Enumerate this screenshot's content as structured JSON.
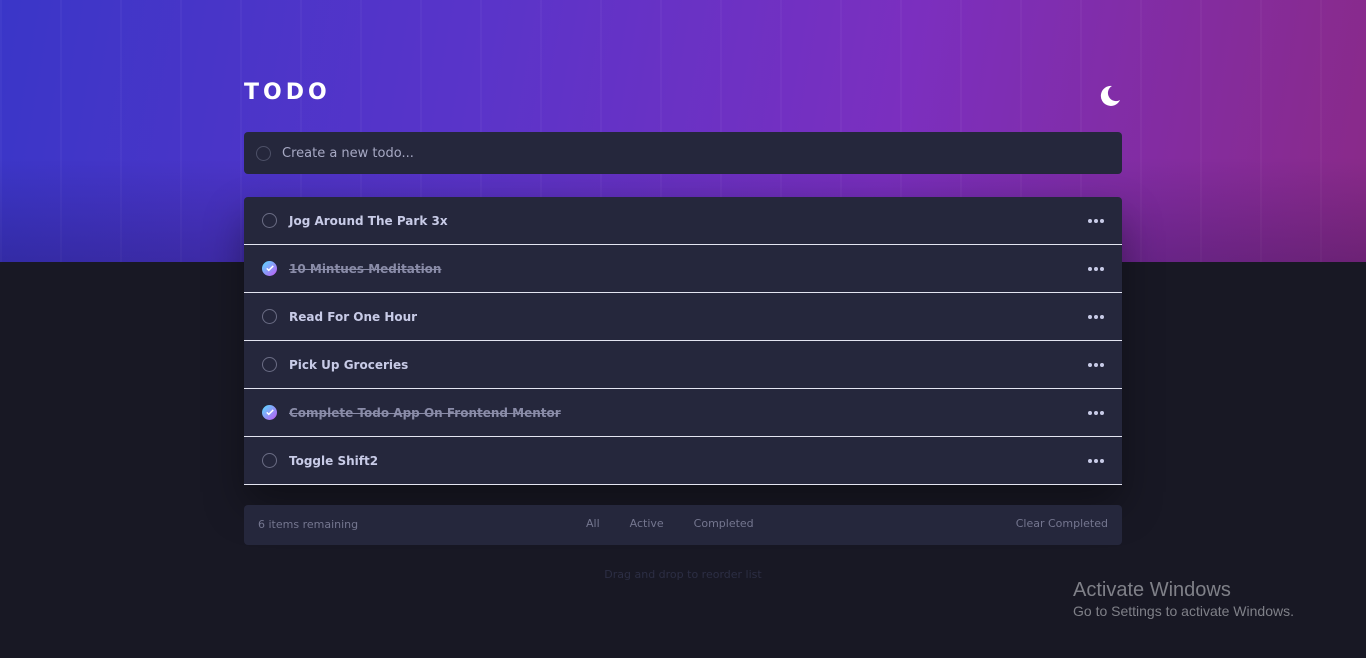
{
  "header": {
    "title": "TODO",
    "theme_icon": "moon-icon"
  },
  "new_todo": {
    "placeholder": "Create a new todo...",
    "value": ""
  },
  "todos": [
    {
      "text": "Jog Around The Park 3x",
      "completed": false
    },
    {
      "text": "10 Mintues Meditation",
      "completed": true
    },
    {
      "text": "Read For One Hour",
      "completed": false
    },
    {
      "text": "Pick Up Groceries",
      "completed": false
    },
    {
      "text": "Complete Todo App On Frontend Mentor",
      "completed": true
    },
    {
      "text": "Toggle Shift2",
      "completed": false
    }
  ],
  "footer": {
    "items_remaining": "6 items remaining",
    "filters": [
      "All",
      "Active",
      "Completed"
    ],
    "clear_label": "Clear Completed"
  },
  "hint": "Drag and drop to reorder list",
  "watermark": {
    "title": "Activate Windows",
    "subtitle": "Go to Settings to activate Windows."
  },
  "colors": {
    "card_bg": "#25273c",
    "page_bg": "#181824",
    "text": "#c8cbe7",
    "check_gradient_start": "#57ddff",
    "check_gradient_end": "#c058f3"
  }
}
